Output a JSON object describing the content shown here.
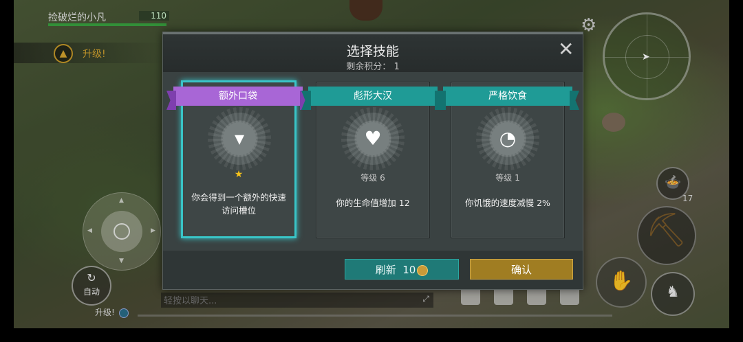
{
  "hud": {
    "player_name": "捡破烂的小凡",
    "hp": "110",
    "levelup_label": "升级!",
    "auto_label": "自动",
    "chat_placeholder": "轻按以聊天...",
    "levelup_bottom": "升级!",
    "food_count": "17"
  },
  "dialog": {
    "title": "选择技能",
    "points_label": "剩余积分：",
    "points_value": "1",
    "cards": [
      {
        "name": "额外口袋",
        "level": "",
        "desc": "你会得到一个额外的快速访问槽位",
        "icon": "pocket-icon",
        "selected": true,
        "ribbon": "purple"
      },
      {
        "name": "彪形大汉",
        "level": "等级 6",
        "desc": "你的生命值增加 12",
        "icon": "heart-icon",
        "selected": false,
        "ribbon": "teal"
      },
      {
        "name": "严格饮食",
        "level": "等级 1",
        "desc": "你饥饿的速度减慢 2%",
        "icon": "stomach-clock-icon",
        "selected": false,
        "ribbon": "teal"
      }
    ],
    "refresh_label": "刷新",
    "refresh_cost": "10",
    "confirm_label": "确认"
  },
  "colors": {
    "accent_teal": "#1f9b96",
    "accent_purple": "#a866d6",
    "confirm_gold": "#a07d22",
    "hp_green": "#3aa340"
  }
}
